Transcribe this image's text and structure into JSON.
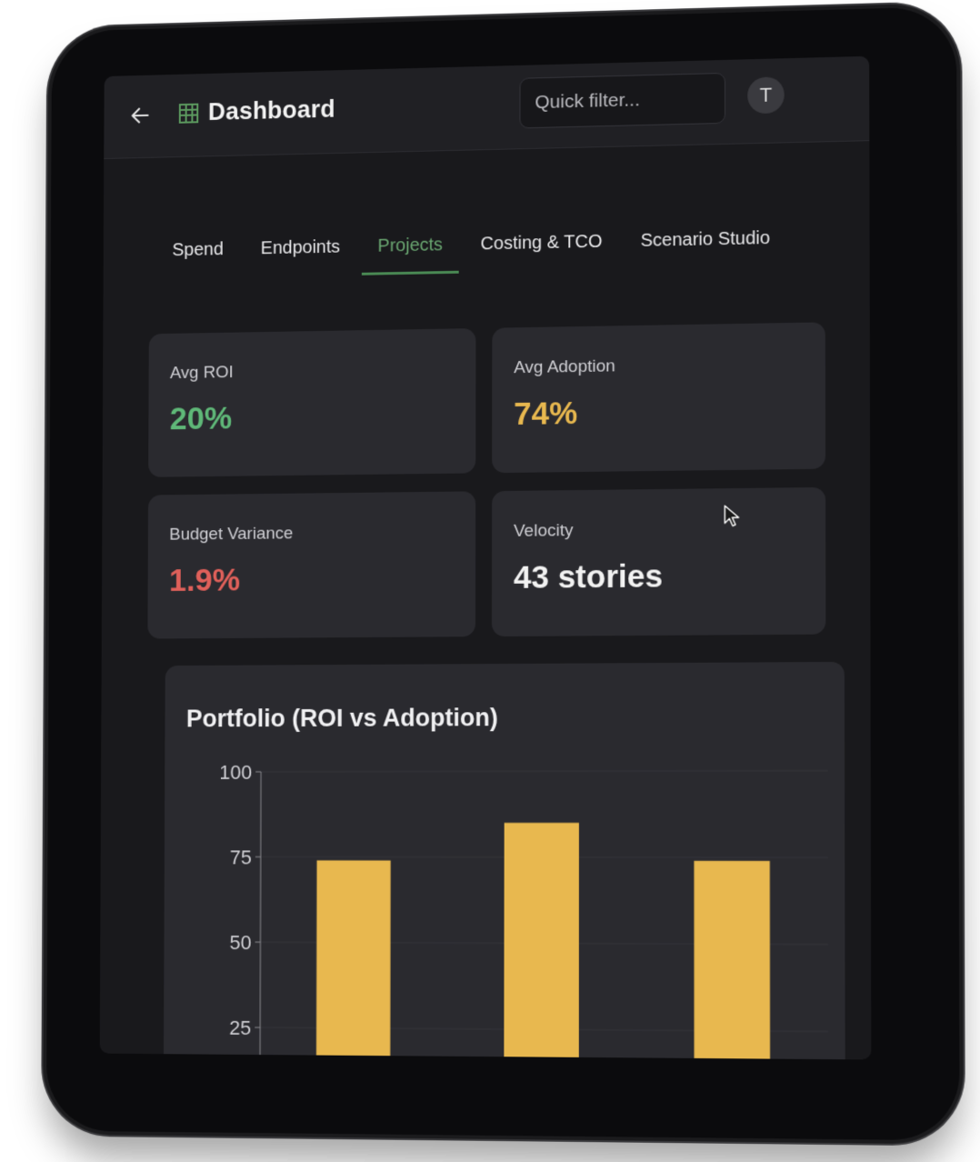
{
  "header": {
    "title": "Dashboard",
    "search_placeholder": "Quick filter...",
    "avatar_initial": "T"
  },
  "tabs": [
    {
      "label": "Spend",
      "active": false
    },
    {
      "label": "Endpoints",
      "active": false
    },
    {
      "label": "Projects",
      "active": true
    },
    {
      "label": "Costing & TCO",
      "active": false
    },
    {
      "label": "Scenario Studio",
      "active": false
    }
  ],
  "metrics": [
    {
      "label": "Avg ROI",
      "value": "20%",
      "color": "#5fb878"
    },
    {
      "label": "Avg Adoption",
      "value": "74%",
      "color": "#e8b84f"
    },
    {
      "label": "Budget Variance",
      "value": "1.9%",
      "color": "#e0605a"
    },
    {
      "label": "Velocity",
      "value": "43 stories",
      "color": "#f2f2f2"
    }
  ],
  "colors": {
    "accent": "#4a8a54",
    "bar": "#e8b84f",
    "panel": "#2a2a2f",
    "background": "#19191c"
  },
  "chart_data": {
    "type": "bar",
    "title": "Portfolio (ROI vs Adoption)",
    "xlabel": "",
    "ylabel": "",
    "ylim": [
      0,
      100
    ],
    "yticks": [
      25,
      50,
      75,
      100
    ],
    "categories": [
      "",
      "",
      ""
    ],
    "values": [
      74,
      85,
      74
    ],
    "grid": true
  }
}
